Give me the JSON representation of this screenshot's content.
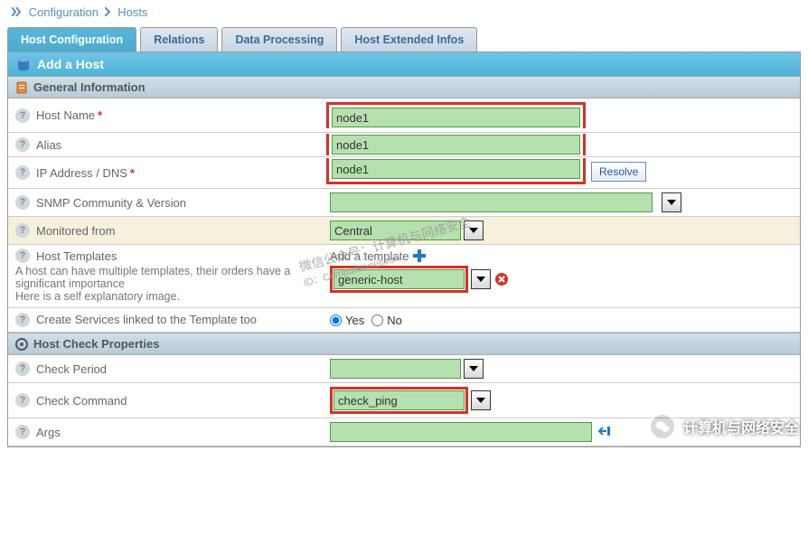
{
  "breadcrumb": {
    "level1": "Configuration",
    "level2": "Hosts"
  },
  "tabs": [
    {
      "label": "Host Configuration",
      "active": true
    },
    {
      "label": "Relations",
      "active": false
    },
    {
      "label": "Data Processing",
      "active": false
    },
    {
      "label": "Host Extended Infos",
      "active": false
    }
  ],
  "panel_title": "Add a Host",
  "sections": {
    "general": "General Information",
    "check": "Host Check Properties"
  },
  "fields": {
    "host_name": {
      "label": "Host Name",
      "value": "node1",
      "required": true
    },
    "alias": {
      "label": "Alias",
      "value": "node1",
      "required": false
    },
    "ip": {
      "label": "IP Address / DNS",
      "value": "node1",
      "required": true,
      "resolve_btn": "Resolve"
    },
    "snmp": {
      "label": "SNMP Community & Version",
      "value": ""
    },
    "monitored": {
      "label": "Monitored from",
      "value": "Central"
    },
    "templates": {
      "label": "Host Templates",
      "hint1": "A host can have multiple templates, their orders have a significant importance",
      "hint2": "Here is a self explanatory image.",
      "add_label": "Add a template",
      "items": [
        {
          "value": "generic-host"
        }
      ]
    },
    "create_services": {
      "label": "Create Services linked to the Template too",
      "yes": "Yes",
      "no": "No",
      "value": "Yes"
    },
    "check_period": {
      "label": "Check Period",
      "value": ""
    },
    "check_command": {
      "label": "Check Command",
      "value": "check_ping"
    },
    "args": {
      "label": "Args",
      "value": ""
    }
  },
  "watermark": {
    "line1": "微信公众号：计算机与网络安全",
    "line2": "ID：Computer-network"
  },
  "badge": "计算机与网络安全"
}
